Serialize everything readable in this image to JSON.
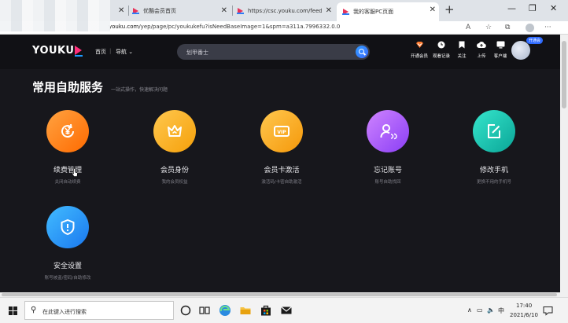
{
  "browser": {
    "tabs": [
      {
        "title": "优酷会员首页",
        "active": false
      },
      {
        "title": "https://csc.youku.com/feedback",
        "active": false
      },
      {
        "title": "我的客服PC页面",
        "active": true
      }
    ],
    "address": {
      "domain": "youku.com",
      "path": "/yep/page/pc/youkukefu?isNeedBaseImage=1&spm=a311a.7996332.0.0"
    }
  },
  "header": {
    "logo": "YOUKU",
    "nav_home": "首页",
    "nav_separator": "|",
    "nav_menu": "导航",
    "search_placeholder": "划甲番士",
    "icons": [
      {
        "icon": "vip-diamond-icon",
        "label": "开通会员"
      },
      {
        "icon": "history-clock-icon",
        "label": "观看记录"
      },
      {
        "icon": "bookmark-icon",
        "label": "关注"
      },
      {
        "icon": "upload-cloud-icon",
        "label": "上传"
      },
      {
        "icon": "client-monitor-icon",
        "label": "客户端"
      }
    ],
    "vip_badge": "开通会"
  },
  "main": {
    "title": "常用自助服务",
    "subtitle": "一站式操作，快速解决问题",
    "services": [
      {
        "label": "续费管理",
        "desc": "关闭自动续费",
        "color_from": "#ff9a3d",
        "color_to": "#ff6a00",
        "icon": "yen-refresh-icon"
      },
      {
        "label": "会员身份",
        "desc": "我的会员权益",
        "color_from": "#ffc44d",
        "color_to": "#f5a20a",
        "icon": "crown-icon"
      },
      {
        "label": "会员卡激活",
        "desc": "激活码/卡密自助激活",
        "color_from": "#ffc44d",
        "color_to": "#f59a0a",
        "icon": "vip-card-icon"
      },
      {
        "label": "忘记账号",
        "desc": "账号自助找回",
        "color_from": "#c77cff",
        "color_to": "#8a3df5",
        "icon": "user-search-icon"
      },
      {
        "label": "修改手机",
        "desc": "更换不用的手机号",
        "color_from": "#2fe0c8",
        "color_to": "#0aa89a",
        "icon": "edit-note-icon"
      },
      {
        "label": "安全设置",
        "desc": "账号被盗/密码/自助修改",
        "color_from": "#3db6ff",
        "color_to": "#1a7cf0",
        "icon": "shield-icon"
      }
    ]
  },
  "taskbar": {
    "search_placeholder": "在此键入进行搜索",
    "tray_chevron": "∧",
    "tray_lang": "中",
    "time": "17:40",
    "date": "2021/6/10"
  }
}
